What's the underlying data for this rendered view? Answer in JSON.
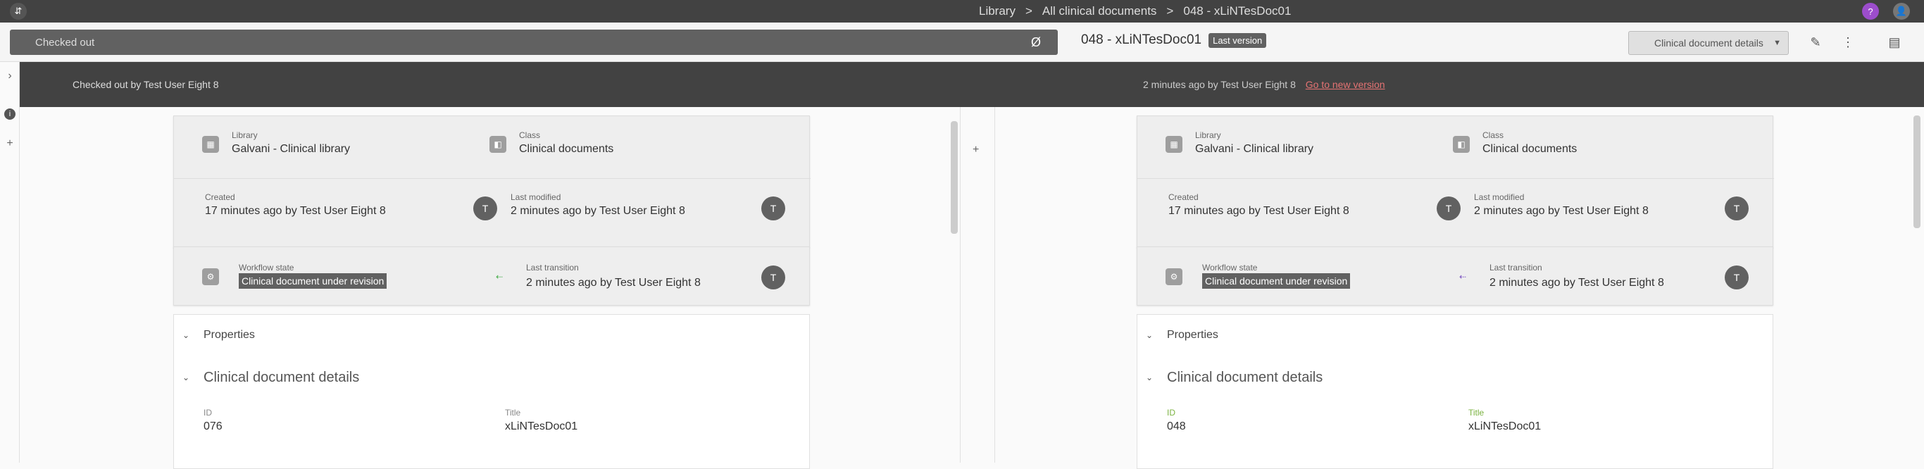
{
  "topbar": {
    "breadcrumbs": [
      "Library",
      "All clinical documents",
      "048 - xLiNTesDoc01"
    ],
    "separator": ">",
    "left_icon": "chevron-icon",
    "right_icons": [
      "help-icon",
      "user-icon"
    ]
  },
  "toolbar": {
    "compare_left": "Checked out",
    "compare_right": "Ø",
    "doc_title": "048 - xLiNTesDoc01",
    "doc_badge": "Last version",
    "menu_label": "Clinical document details",
    "icons": [
      "edit-icon",
      "more-icon",
      "panel-icon"
    ]
  },
  "banner": {
    "left_text": "Checked out by Test User Eight 8",
    "right_text": "2 minutes ago by Test User Eight 8",
    "right_link": "Go to new version"
  },
  "left": {
    "library_label": "Library",
    "library_value": "Galvani - Clinical library",
    "class_label": "Class",
    "class_value": "Clinical documents",
    "created_label": "Created",
    "created_value": "17 minutes ago by Test User Eight 8",
    "modified_label": "Last modified",
    "modified_value": "2 minutes ago by Test User Eight 8",
    "workflow_label": "Workflow state",
    "workflow_value": "Clinical document under revision",
    "transition_label": "Last transition",
    "transition_value": "2 minutes ago by Test User Eight 8",
    "properties": "Properties",
    "section": "Clinical document details",
    "id_label": "ID",
    "id_value": "076",
    "title_label": "Title",
    "title_value": "xLiNTesDoc01"
  },
  "right": {
    "library_label": "Library",
    "library_value": "Galvani - Clinical library",
    "class_label": "Class",
    "class_value": "Clinical documents",
    "created_label": "Created",
    "created_value": "17 minutes ago by Test User Eight 8",
    "modified_label": "Last modified",
    "modified_value": "2 minutes ago by Test User Eight 8",
    "workflow_label": "Workflow state",
    "workflow_value": "Clinical document under revision",
    "transition_label": "Last transition",
    "transition_value": "2 minutes ago by Test User Eight 8",
    "properties": "Properties",
    "section": "Clinical document details",
    "id_label": "ID",
    "id_value": "048",
    "title_label": "Title",
    "title_value": "xLiNTesDoc01"
  },
  "avatar_initial": "T",
  "colors": {
    "topbar": "#424242",
    "banner": "#424242",
    "link": "#e57373"
  }
}
